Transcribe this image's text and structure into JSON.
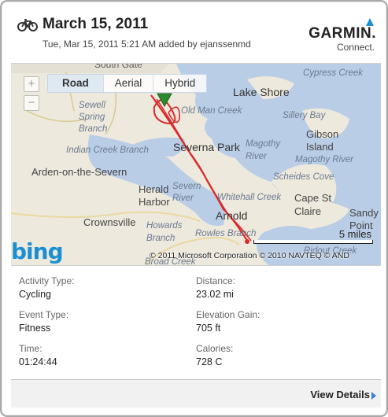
{
  "header": {
    "title": "March 15, 2011",
    "subtitle": "Tue, Mar 15, 2011 5:21 AM added by ejanssenmd",
    "activity_icon": "bicycle-icon"
  },
  "brand": {
    "name": "GARMIN.",
    "sub": "Connect.",
    "accent_color": "#1b8fd1"
  },
  "map": {
    "tabs": [
      {
        "label": "Road",
        "active": true
      },
      {
        "label": "Aerial",
        "active": false
      },
      {
        "label": "Hybrid",
        "active": false
      }
    ],
    "zoom_in": "+",
    "zoom_out": "−",
    "scale_label": "5 miles",
    "provider": "bing",
    "copyright": "© 2011 Microsoft Corporation   © 2010 NAVTEQ   © AND",
    "labels": {
      "south_gate": "South Gate",
      "lake_shore": "Lake Shore",
      "old_man_creek": "Old Man Creek",
      "sewell_spring_branch": "Sewell Spring Branch",
      "cypress_creek": "Cypress Creek",
      "sillery_bay": "Sillery Bay",
      "gibson_island": "Gibson Island",
      "indian_creek_branch": "Indian Creek Branch",
      "severna_park": "Severna Park",
      "magothy_river": "Magothy River",
      "magothy_river_2": "Magothy River",
      "arden": "Arden-on-the-Severn",
      "scheides_cove": "Scheides Cove",
      "herald_harbor": "Herald Harbor",
      "severn_river": "Severn River",
      "whitehall_creek": "Whitehall Creek",
      "cape_st_claire": "Cape St Claire",
      "sandy_point": "Sandy Point",
      "crownsville": "Crownsville",
      "arnold": "Arnold",
      "howards_branch": "Howards Branch",
      "rowles_branch": "Rowles Branch",
      "ridout_creek": "Ridout Creek",
      "broad_creek": "Broad Creek"
    }
  },
  "details": {
    "activity_type": {
      "label": "Activity Type:",
      "value": "Cycling"
    },
    "distance": {
      "label": "Distance:",
      "value": "23.02 mi"
    },
    "event_type": {
      "label": "Event Type:",
      "value": "Fitness"
    },
    "elevation_gain": {
      "label": "Elevation Gain:",
      "value": "705 ft"
    },
    "time": {
      "label": "Time:",
      "value": "01:24:44"
    },
    "calories": {
      "label": "Calories:",
      "value": "728 C"
    }
  },
  "footer": {
    "view_details": "View Details"
  }
}
